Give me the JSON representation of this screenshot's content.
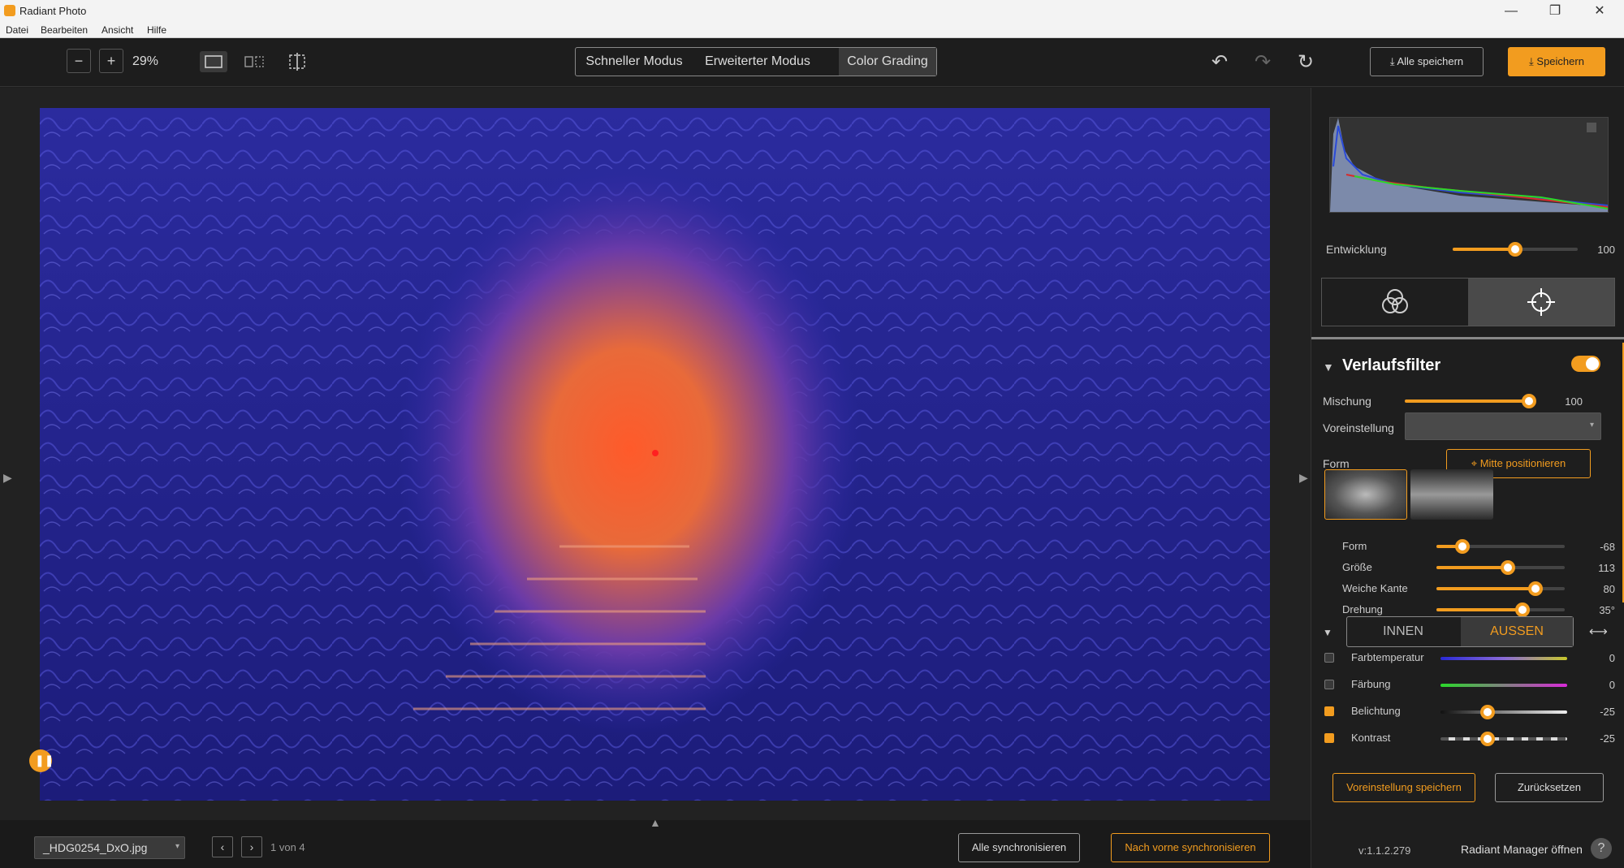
{
  "window": {
    "title": "Radiant Photo",
    "min": "—",
    "max": "❐",
    "close": "✕"
  },
  "menu": [
    "Datei",
    "Bearbeiten",
    "Ansicht",
    "Hilfe"
  ],
  "toolbar": {
    "zoom_out": "−",
    "zoom_in": "+",
    "zoom": "29%",
    "modes": [
      "Schneller Modus",
      "Erweiterter Modus",
      "Color Grading"
    ],
    "active_mode": "Color Grading",
    "undo": "↶",
    "redo": "↷",
    "reset": "↻",
    "save_all": "Alle speichern",
    "save": "Speichern"
  },
  "bottom": {
    "file": "_HDG0254_DxO.jpg",
    "prev": "‹",
    "next": "›",
    "page": "1 von 4",
    "sync_all": "Alle synchronisieren",
    "sync_forward": "Nach vorne synchronisieren"
  },
  "panel": {
    "entwicklung": {
      "label": "Entwicklung",
      "value": 100,
      "fraction": 0.5
    },
    "section_title": "Verlaufsfilter",
    "section_enabled": true,
    "mischung": {
      "label": "Mischung",
      "value": 100,
      "fraction": 0.95
    },
    "voreinstellung": {
      "label": "Voreinstellung",
      "value": ""
    },
    "form_label": "Form",
    "center_button": "Mitte positionieren",
    "shape_sliders": [
      {
        "label": "Form",
        "value": "-68",
        "fraction": 0.2
      },
      {
        "label": "Größe",
        "value": "113",
        "fraction": 0.56
      },
      {
        "label": "Weiche Kante",
        "value": "80",
        "fraction": 0.77
      },
      {
        "label": "Drehung",
        "value": "35°",
        "fraction": 0.67
      }
    ],
    "inout": [
      "INNEN",
      "AUSSEN"
    ],
    "inout_active": "AUSSEN",
    "adjustments": [
      {
        "label": "Farbtemperatur",
        "value": "0",
        "checked": false
      },
      {
        "label": "Färbung",
        "value": "0",
        "checked": false
      },
      {
        "label": "Belichtung",
        "value": "-25",
        "checked": true,
        "fraction": 0.37
      },
      {
        "label": "Kontrast",
        "value": "-25",
        "checked": true,
        "fraction": 0.37
      }
    ],
    "save_preset": "Voreinstellung speichern",
    "reset": "Zurücksetzen",
    "version": "v:1.1.2.279",
    "manager": "Radiant Manager öffnen",
    "help": "?"
  },
  "colors": {
    "accent": "#f29c1f",
    "photo_overlay": "#2a2aa8",
    "glow": "#ff6a2a"
  }
}
